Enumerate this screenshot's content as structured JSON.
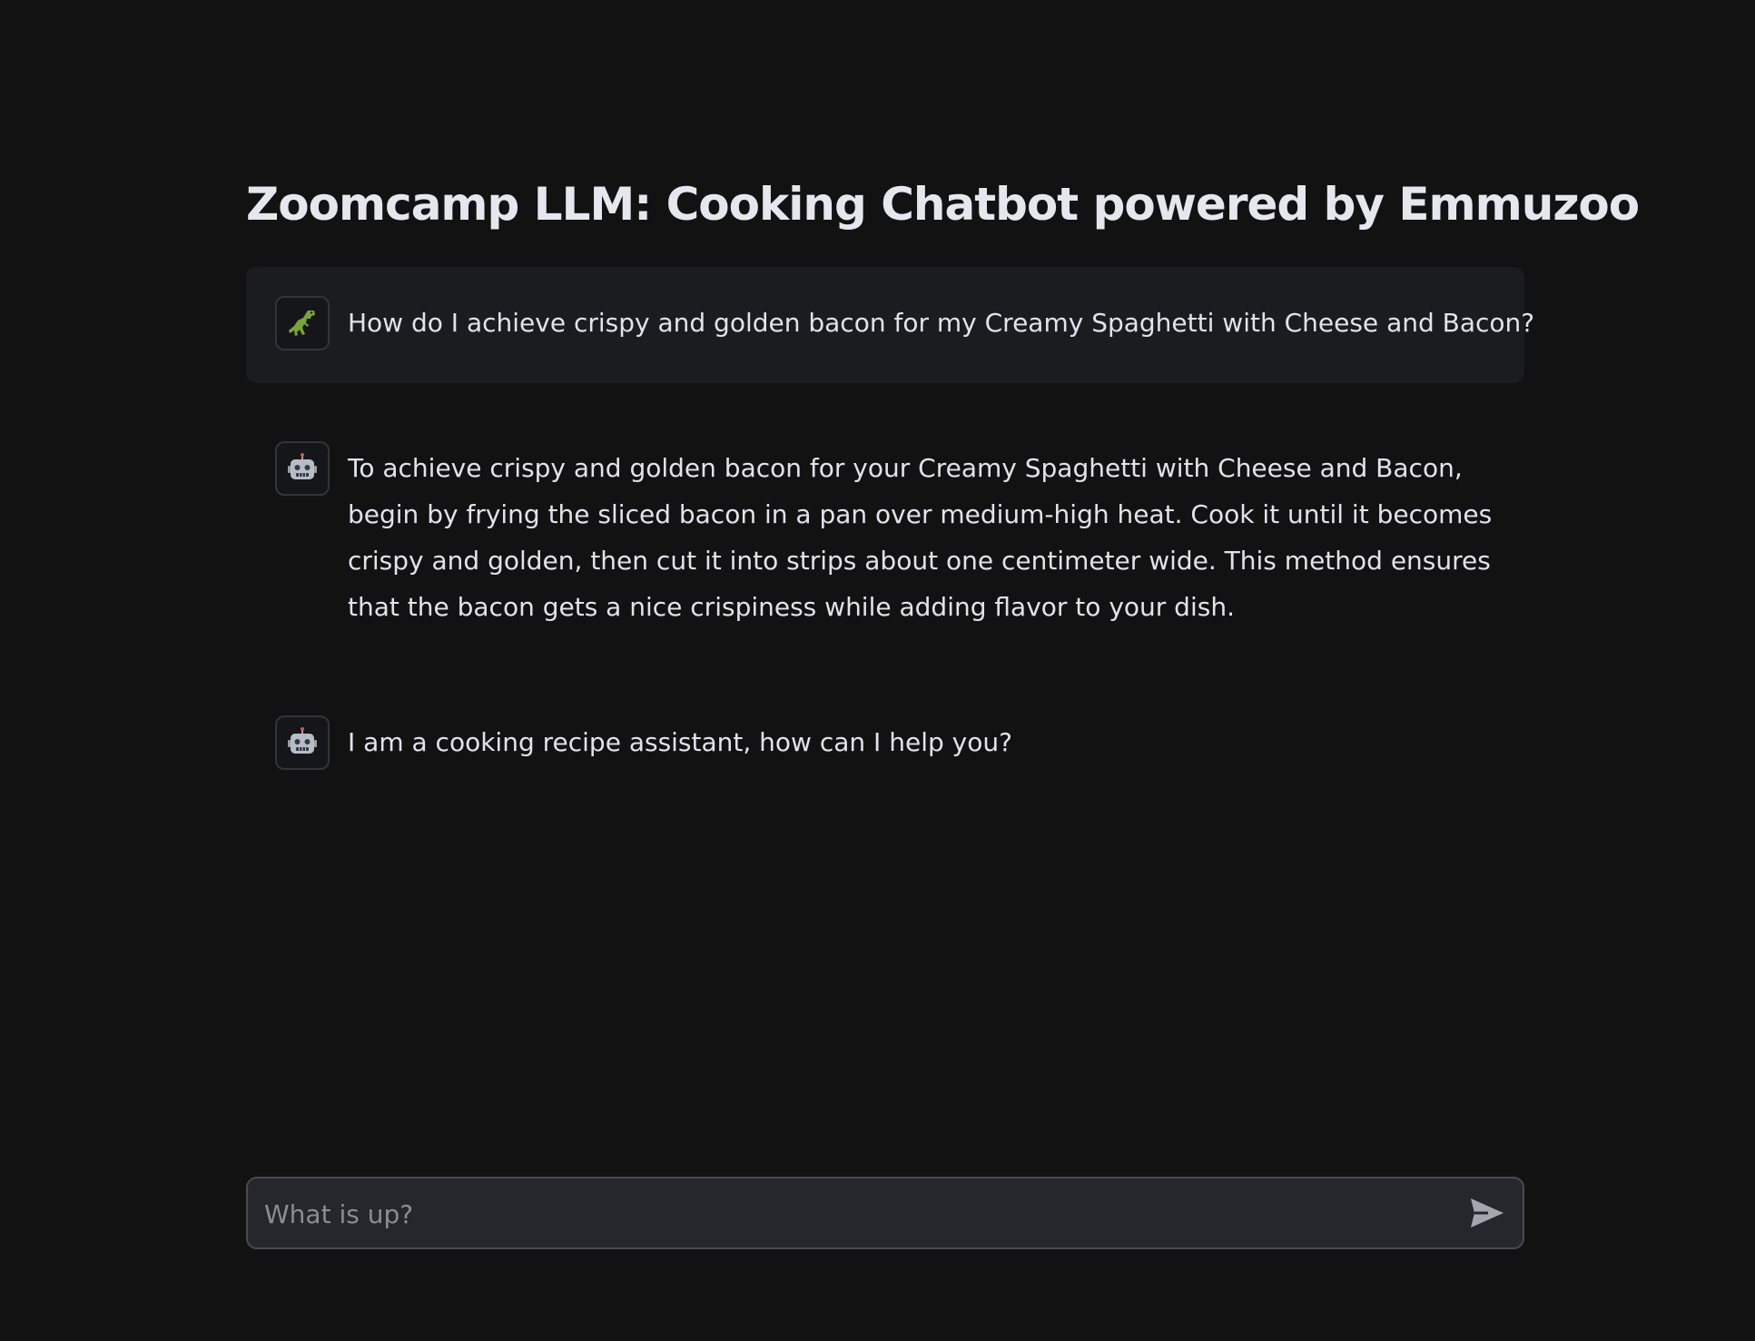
{
  "page": {
    "title": "Zoomcamp LLM: Cooking Chatbot powered by Emmuzoo"
  },
  "messages": [
    {
      "role": "user",
      "avatar_icon": "dinosaur-icon",
      "text": "How do I achieve crispy and golden bacon for my Creamy Spaghetti with Cheese and Bacon?"
    },
    {
      "role": "assistant",
      "avatar_icon": "robot-icon",
      "text": "To achieve crispy and golden bacon for your Creamy Spaghetti with Cheese and Bacon, begin by frying the sliced bacon in a pan over medium-high heat. Cook it until it becomes crispy and golden, then cut it into strips about one centimeter wide. This method ensures that the bacon gets a nice crispiness while adding flavor to your dish."
    },
    {
      "role": "assistant",
      "avatar_icon": "robot-icon",
      "text": "I am a cooking recipe assistant, how can I help you?"
    }
  ],
  "chat_input": {
    "placeholder": "What is up?",
    "value": "",
    "send_icon": "send-icon"
  },
  "colors": {
    "background": "#121213",
    "user_bubble": "#1b1c20",
    "input_background": "#26272c",
    "input_border": "#4a4b52",
    "text": "#e4e4ea",
    "placeholder": "#8b8c94"
  }
}
